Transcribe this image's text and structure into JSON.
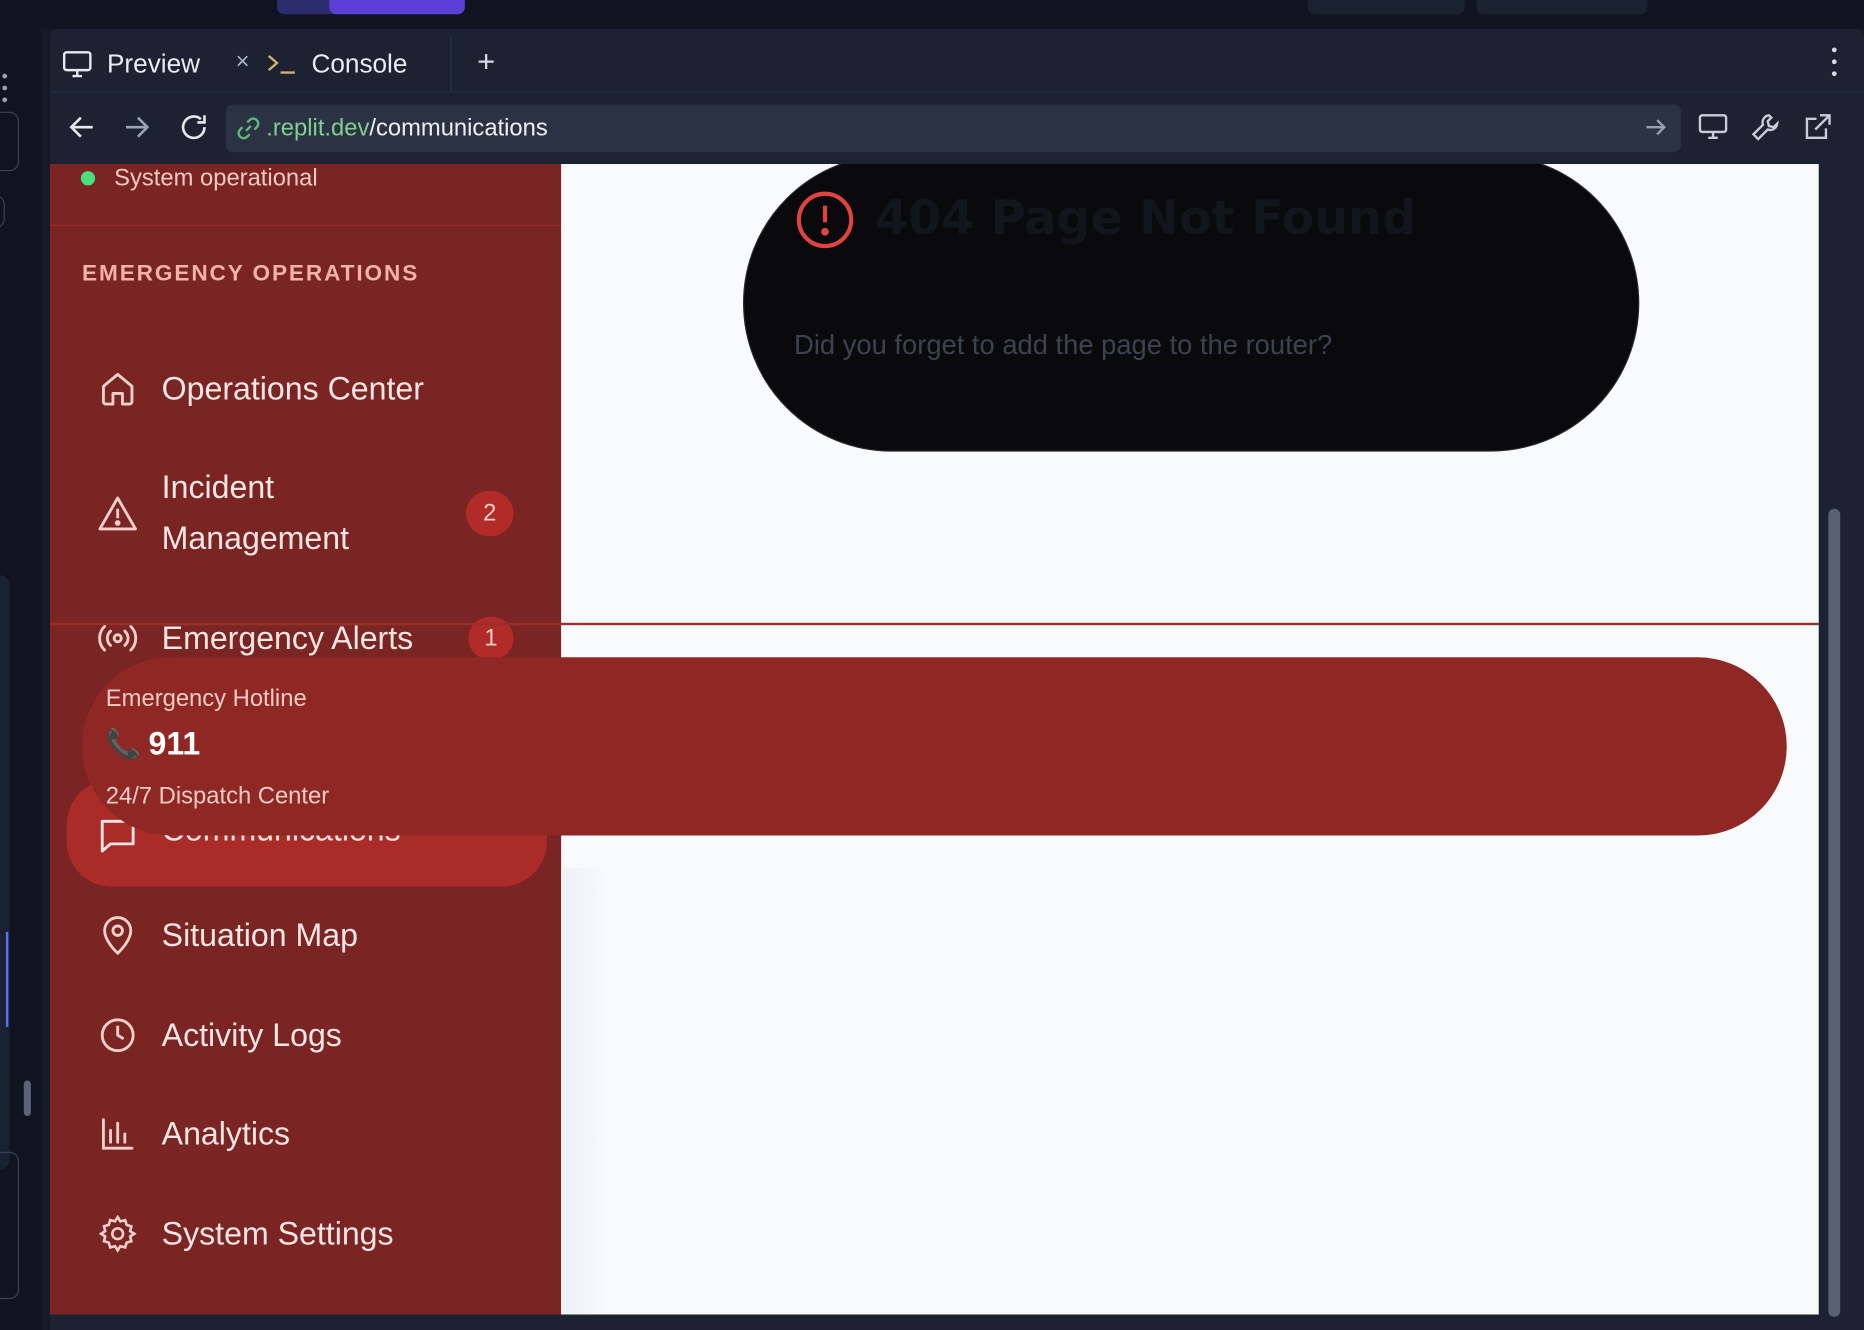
{
  "browser": {
    "tabs": [
      {
        "label": "Preview",
        "icon": "monitor-icon"
      },
      {
        "label": "Console",
        "icon": "terminal-icon"
      }
    ],
    "close_symbol": "×",
    "add_symbol": "+",
    "url_host": ".replit.dev",
    "url_path": "/communications"
  },
  "sidebar": {
    "status_text": "System operational",
    "section_title": "EMERGENCY OPERATIONS",
    "items": [
      {
        "label": "Operations Center",
        "icon": "home-icon"
      },
      {
        "label": "Incident Management",
        "icon": "warning-triangle-icon",
        "badge": "2"
      },
      {
        "label": "Emergency Alerts",
        "icon": "broadcast-icon",
        "badge": "1"
      },
      {
        "label": "Communications",
        "icon": "chat-bubble-icon",
        "active": true
      },
      {
        "label": "Situation Map",
        "icon": "map-pin-icon"
      },
      {
        "label": "Activity Logs",
        "icon": "clock-icon"
      },
      {
        "label": "Analytics",
        "icon": "bar-chart-icon"
      },
      {
        "label": "System Settings",
        "icon": "gear-icon"
      }
    ]
  },
  "hotline": {
    "title": "Emergency Hotline",
    "number": "911",
    "subtitle": "24/7 Dispatch Center"
  },
  "not_found": {
    "title": "404 Page Not Found",
    "message": "Did you forget to add the page to the router?"
  },
  "colors": {
    "sidebar_bg": "#7a2424",
    "active_item": "#ab2b28",
    "hotline_bg": "#8f2824",
    "status_dot": "#4ade80",
    "alert_red": "#e1443f",
    "url_host_green": "#7fd08e"
  }
}
